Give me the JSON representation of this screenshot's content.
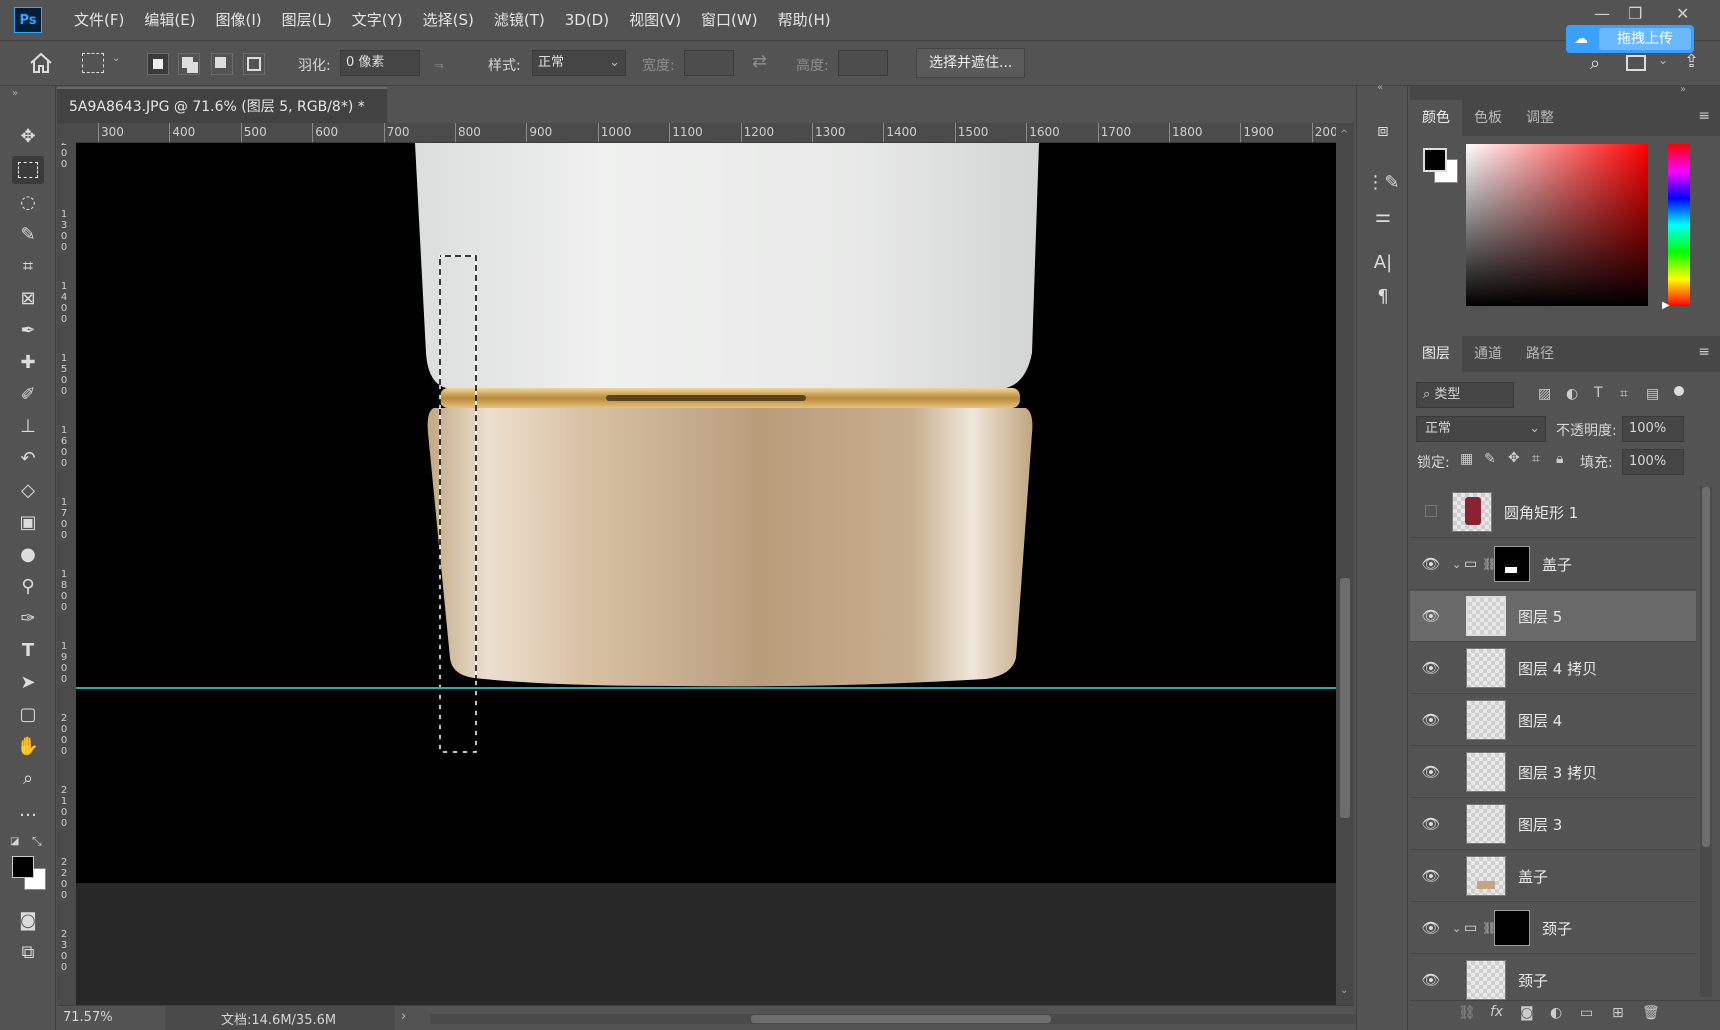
{
  "app": {
    "logo": "Ps"
  },
  "menu": [
    "文件(F)",
    "编辑(E)",
    "图像(I)",
    "图层(L)",
    "文字(Y)",
    "选择(S)",
    "滤镜(T)",
    "3D(D)",
    "视图(V)",
    "窗口(W)",
    "帮助(H)"
  ],
  "window_controls": {
    "minimize": "—",
    "restore": "❐",
    "close": "✕"
  },
  "options_bar": {
    "feather_label": "羽化:",
    "feather_value": "0 像素",
    "style_label": "样式:",
    "style_value": "正常",
    "width_label": "宽度:",
    "height_label": "高度:",
    "select_mask_button": "选择并遮住..."
  },
  "upload_button": "拖拽上传",
  "document_tab": {
    "title": "5A9A8643.JPG @ 71.6% (图层 5, RGB/8*) *",
    "close": "×"
  },
  "ruler_h_labels": [
    "300",
    "400",
    "500",
    "600",
    "700",
    "800",
    "900",
    "1000",
    "1100",
    "1200",
    "1300",
    "1400",
    "1500",
    "1600",
    "1700",
    "1800",
    "1900",
    "200"
  ],
  "ruler_v_labels": [
    "2\n0\n0",
    "1\n3\n0\n0",
    "1\n4\n0\n0",
    "1\n5\n0\n0",
    "1\n6\n0\n0",
    "1\n7\n0\n0",
    "1\n8\n0\n0",
    "1\n9\n0\n0",
    "2\n0\n0\n0",
    "2\n1\n0\n0",
    "2\n2\n0\n0",
    "2\n3\n0\n0"
  ],
  "status": {
    "zoom": "71.57%",
    "doc": "文档:14.6M/35.6M"
  },
  "color_panel": {
    "tabs": [
      "颜色",
      "色板",
      "调整"
    ],
    "foreground": "#000000",
    "background": "#ffffff"
  },
  "layers_panel": {
    "tabs": [
      "图层",
      "通道",
      "路径"
    ],
    "filter_kind": "类型",
    "blend_mode": "正常",
    "opacity_label": "不透明度:",
    "opacity": "100%",
    "lock_label": "锁定:",
    "fill_label": "填充:",
    "fill": "100%",
    "layers": [
      {
        "name": "圆角矩形 1",
        "visible": false,
        "type": "shape"
      },
      {
        "name": "盖子",
        "visible": true,
        "type": "group"
      },
      {
        "name": "图层 5",
        "visible": true,
        "type": "layer",
        "selected": true
      },
      {
        "name": "图层 4 拷贝",
        "visible": true,
        "type": "layer"
      },
      {
        "name": "图层 4",
        "visible": true,
        "type": "layer"
      },
      {
        "name": "图层 3 拷贝",
        "visible": true,
        "type": "layer"
      },
      {
        "name": "图层 3",
        "visible": true,
        "type": "layer"
      },
      {
        "name": "盖子",
        "visible": true,
        "type": "layer"
      },
      {
        "name": "颈子",
        "visible": true,
        "type": "group"
      },
      {
        "name": "颈子",
        "visible": true,
        "type": "layer"
      }
    ]
  },
  "colors": {
    "accent": "#31a8ff",
    "guide": "#2aa9a9",
    "gold": "#c9a46b",
    "cap": "#b79c7c"
  }
}
